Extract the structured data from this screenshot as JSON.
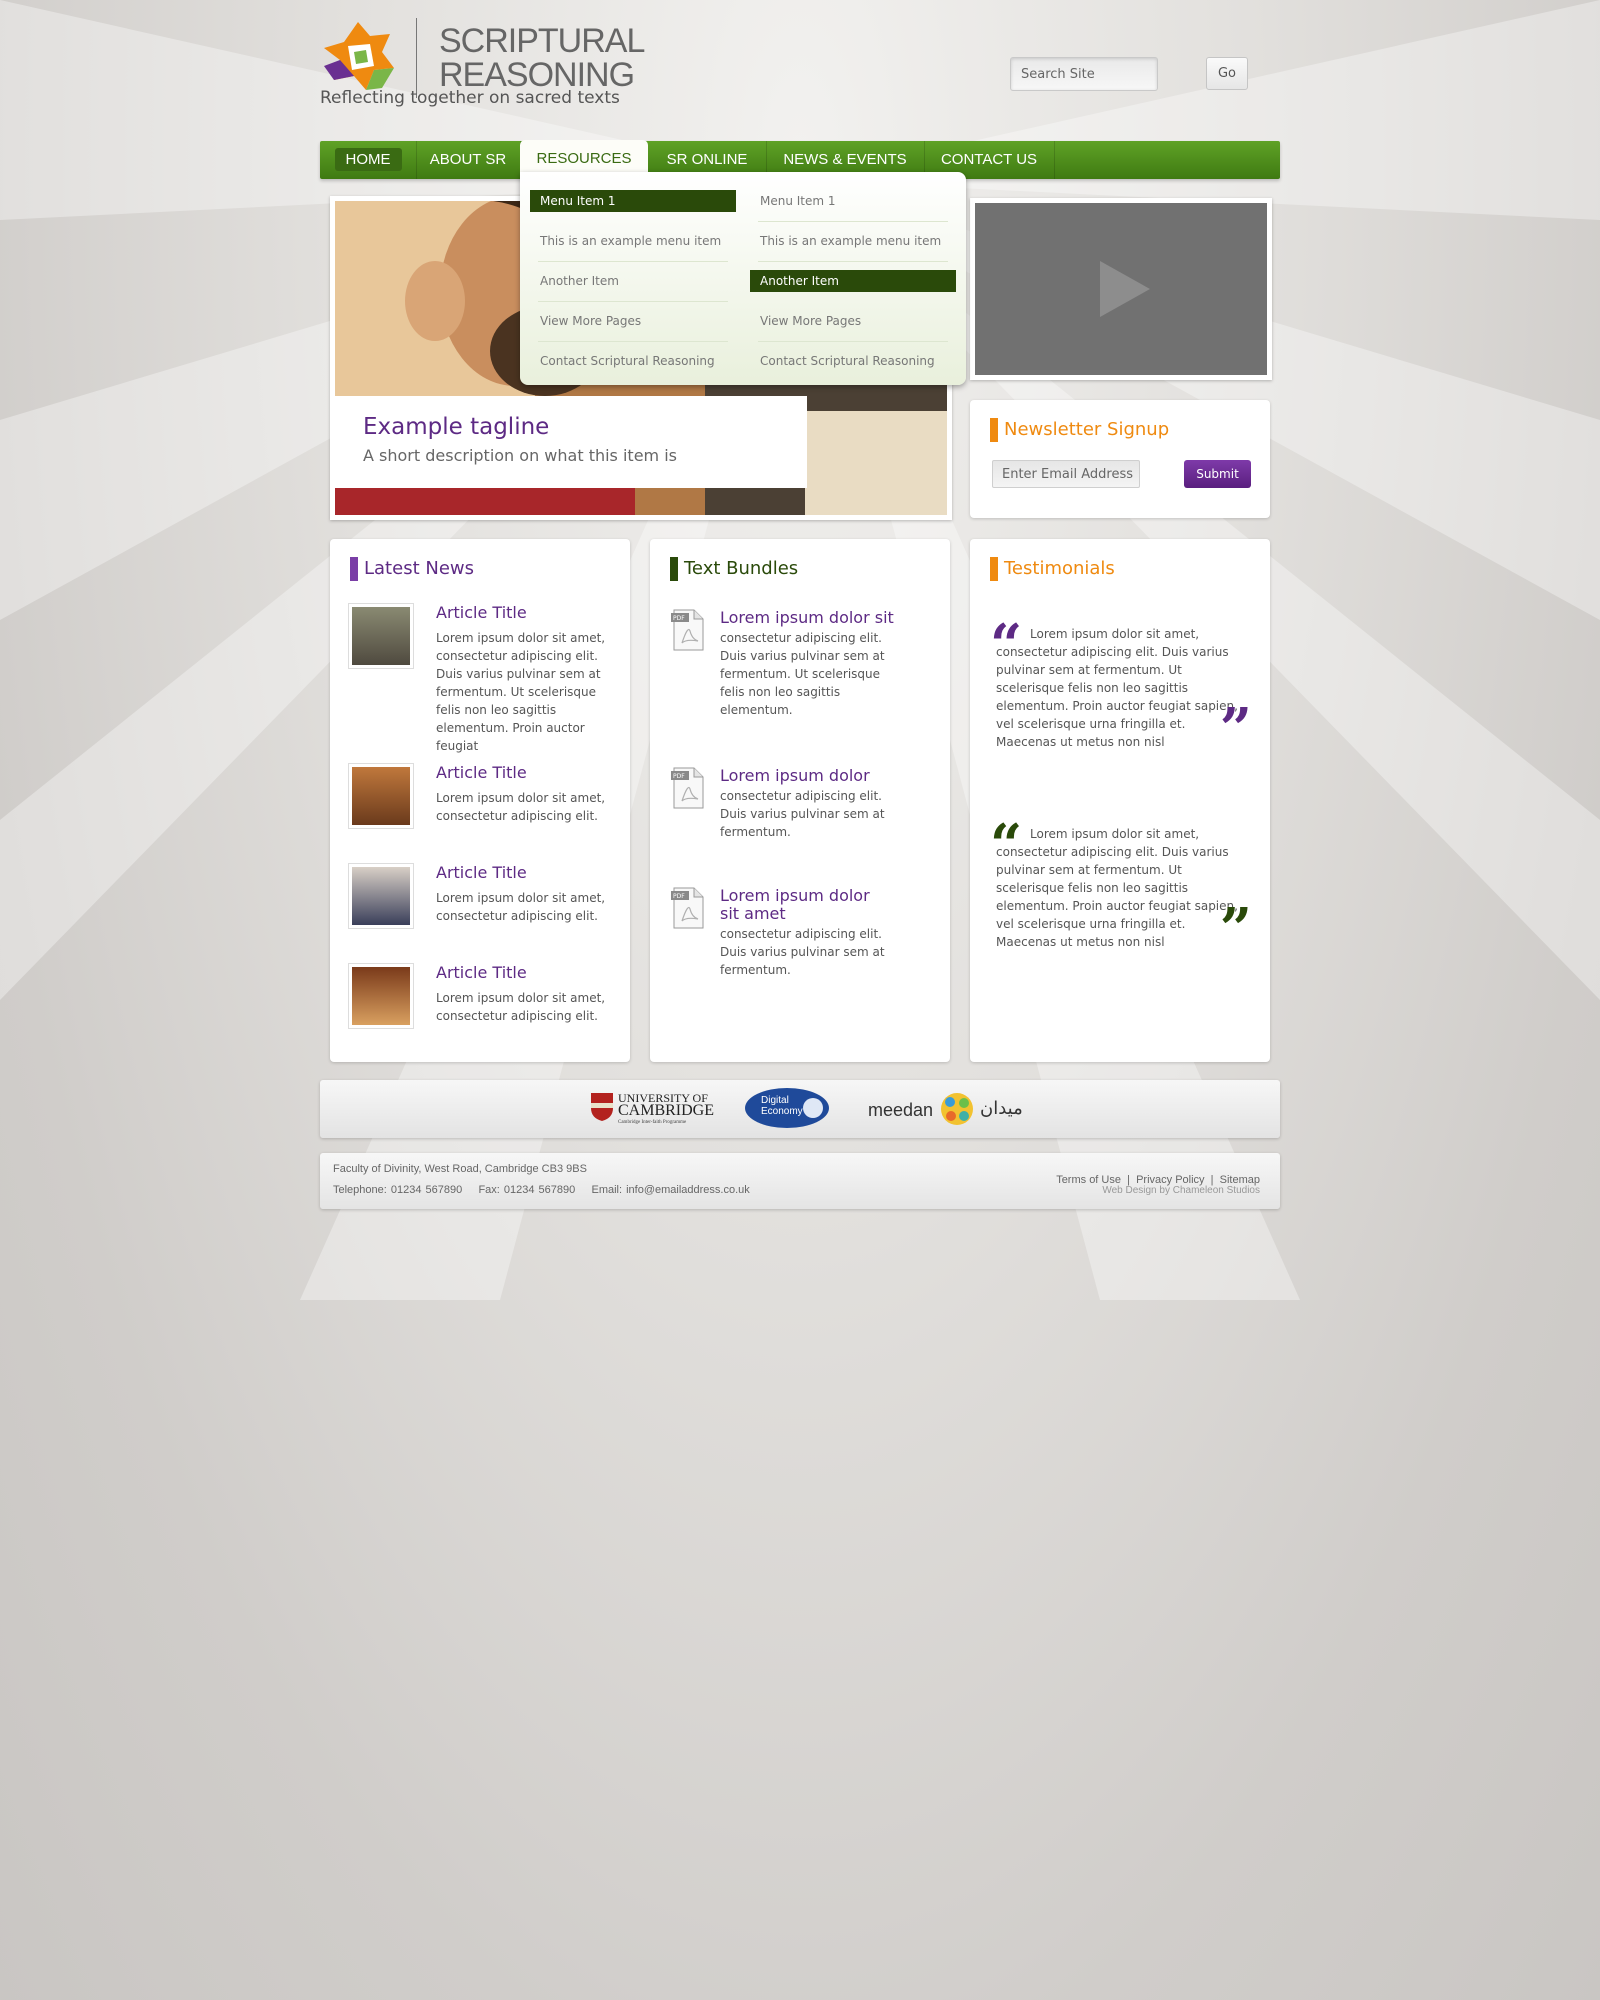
{
  "brand": {
    "logo_line1": "SCRIPTURAL",
    "logo_line2": "REASONING",
    "tagline": "Reflecting together on sacred texts"
  },
  "search": {
    "placeholder": "Search Site",
    "button": "Go"
  },
  "nav": {
    "items": [
      {
        "label": "HOME"
      },
      {
        "label": "ABOUT SR"
      },
      {
        "label": "RESOURCES"
      },
      {
        "label": "SR ONLINE"
      },
      {
        "label": "NEWS & EVENTS"
      },
      {
        "label": "CONTACT US"
      }
    ],
    "active": "RESOURCES"
  },
  "dropdown": {
    "col1": [
      "Menu Item 1",
      "This is an example menu item",
      "Another  Item",
      "View More Pages",
      "Contact Scriptural Reasoning"
    ],
    "col2": [
      "Menu Item 1",
      "This is an example menu item",
      "Another  Item",
      "View More Pages",
      "Contact Scriptural Reasoning"
    ]
  },
  "hero": {
    "title": "Example tagline",
    "description": "A short description on what this item is"
  },
  "newsletter": {
    "title": "Newsletter Signup",
    "placeholder": "Enter Email Address",
    "button": "Submit"
  },
  "latest_news": {
    "title": "Latest News",
    "items": [
      {
        "title": "Article Title",
        "text": "Lorem ipsum dolor sit amet, consectetur adipiscing elit. Duis varius pulvinar sem at fermentum. Ut scelerisque felis non leo sagittis elementum. Proin auctor feugiat"
      },
      {
        "title": "Article Title",
        "text": "Lorem ipsum dolor sit amet, consectetur adipiscing elit."
      },
      {
        "title": "Article Title",
        "text": "Lorem ipsum dolor sit amet, consectetur adipiscing elit."
      },
      {
        "title": "Article Title",
        "text": "Lorem ipsum dolor sit amet, consectetur adipiscing elit."
      }
    ]
  },
  "text_bundles": {
    "title": "Text Bundles",
    "items": [
      {
        "title": "Lorem ipsum dolor sit",
        "text": "consectetur adipiscing elit. Duis varius pulvinar sem at fermentum. Ut scelerisque felis non leo sagittis elementum."
      },
      {
        "title": "Lorem ipsum dolor",
        "text": "consectetur adipiscing elit. Duis varius pulvinar sem at fermentum."
      },
      {
        "title": "Lorem ipsum dolor sit amet",
        "text": "consectetur adipiscing elit. Duis varius pulvinar sem at fermentum."
      }
    ]
  },
  "testimonials": {
    "title": "Testimonials",
    "items": [
      {
        "text": "Lorem ipsum dolor sit amet, consectetur adipiscing elit. Duis varius pulvinar sem at fermentum. Ut scelerisque felis non leo sagittis elementum. Proin auctor feugiat sapien, vel scelerisque urna fringilla et. Maecenas ut metus non nisl"
      },
      {
        "text": "Lorem ipsum dolor sit amet, consectetur adipiscing elit. Duis varius pulvinar sem at fermentum. Ut scelerisque felis non leo sagittis elementum. Proin auctor feugiat sapien, vel scelerisque urna fringilla et. Maecenas ut metus non nisl"
      }
    ]
  },
  "partners": {
    "cambridge_line1": "UNIVERSITY OF",
    "cambridge_line2": "CAMBRIDGE",
    "cambridge_sub": "Cambridge Inter-faith Programme",
    "digital_economy_line1": "Digital",
    "digital_economy_line2": "Economy",
    "meedan": "meedan",
    "meedan_arabic": "ميدان"
  },
  "footer": {
    "address": "Faculty of Divinity, West Road, Cambridge CB3 9BS",
    "contact": "Telephone: 01234 567890    Fax: 01234 567890    Email: info@emailaddress.co.uk",
    "links": [
      "Terms of Use",
      "Privacy Policy",
      "Sitemap"
    ],
    "credit": "Web Design by Chameleon Studios"
  },
  "colors": {
    "nav_green": "#4f8f1c",
    "purple": "#5d2a84",
    "orange": "#ef8a10",
    "dark_green": "#2a4a0a"
  }
}
